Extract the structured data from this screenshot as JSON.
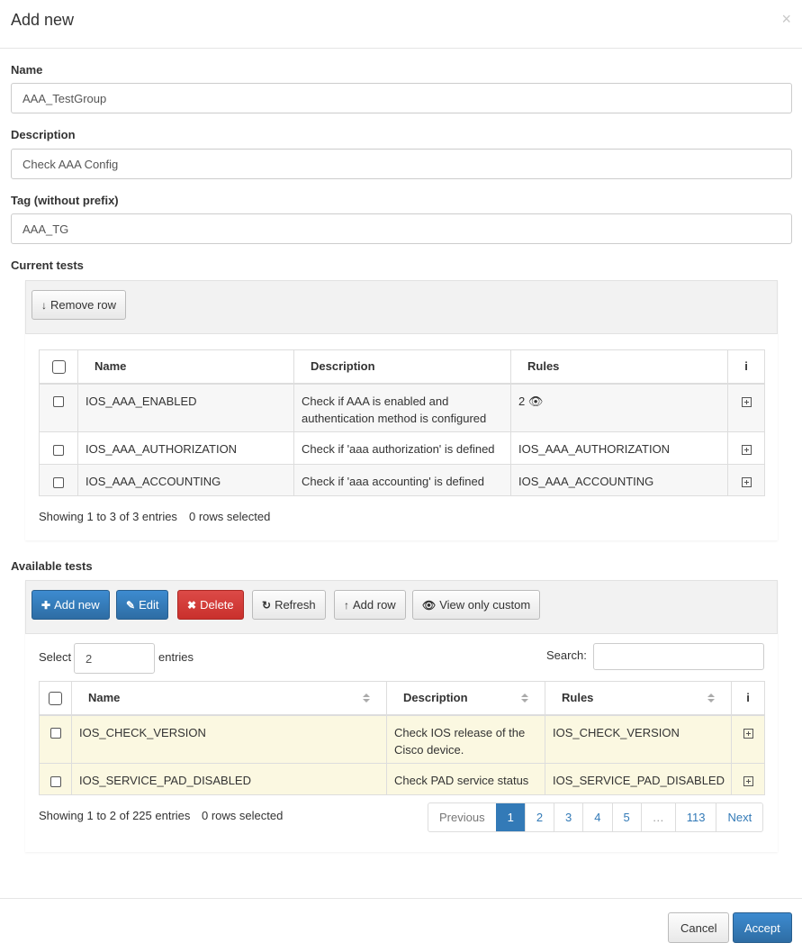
{
  "modal": {
    "title": "Add new",
    "close": "×"
  },
  "form": {
    "name_label": "Name",
    "name_value": "AAA_TestGroup",
    "desc_label": "Description",
    "desc_value": "Check AAA Config",
    "tag_label": "Tag (without prefix)",
    "tag_value": "AAA_TG"
  },
  "current": {
    "section_label": "Current tests",
    "remove_label": "Remove row",
    "columns": [
      "Name",
      "Description",
      "Rules",
      "i"
    ],
    "rows": [
      {
        "name": "IOS_AAA_ENABLED",
        "description": "Check if AAA is enabled and authentication method is configured",
        "rules": "2"
      },
      {
        "name": "IOS_AAA_AUTHORIZATION",
        "description": "Check if 'aaa authorization' is defined",
        "rules": "IOS_AAA_AUTHORIZATION"
      },
      {
        "name": "IOS_AAA_ACCOUNTING",
        "description": "Check if 'aaa accounting' is defined",
        "rules": "IOS_AAA_ACCOUNTING"
      }
    ],
    "info_text": "Showing 1 to 3 of 3 entries",
    "selected_text": "0 rows selected"
  },
  "available": {
    "section_label": "Available tests",
    "buttons": {
      "add_new": "Add new",
      "edit": "Edit",
      "delete": "Delete",
      "refresh": "Refresh",
      "add_row": "Add row",
      "view_custom": "View only custom"
    },
    "select_label": "Select",
    "select_value": "2",
    "entries_label": "entries",
    "search_label": "Search:",
    "columns": [
      "Name",
      "Description",
      "Rules",
      "i"
    ],
    "rows": [
      {
        "name": "IOS_CHECK_VERSION",
        "description": "Check IOS release of the Cisco device.",
        "rules": "IOS_CHECK_VERSION"
      },
      {
        "name": "IOS_SERVICE_PAD_DISABLED",
        "description": "Check PAD service status",
        "rules": "IOS_SERVICE_PAD_DISABLED"
      }
    ],
    "info_text": "Showing 1 to 2 of 225 entries",
    "selected_text": "0 rows selected",
    "pager": {
      "previous": "Previous",
      "pages": [
        "1",
        "2",
        "3",
        "4",
        "5",
        "…",
        "113"
      ],
      "next": "Next",
      "current": "1"
    }
  },
  "footer": {
    "cancel": "Cancel",
    "accept": "Accept"
  }
}
